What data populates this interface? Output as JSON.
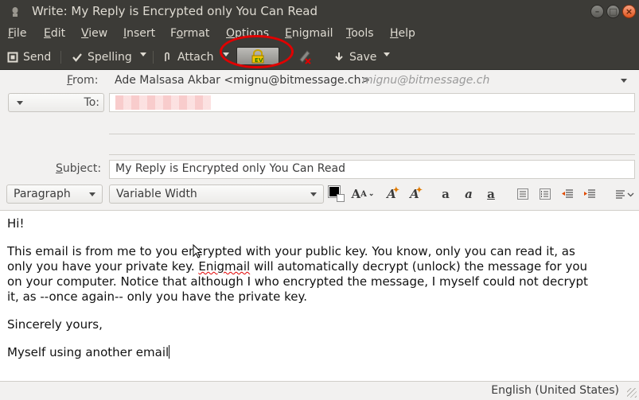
{
  "window": {
    "title": "Write: My Reply is Encrypted only You Can Read",
    "controls": [
      "–",
      "□",
      "×"
    ]
  },
  "menu": [
    {
      "label": "File",
      "accel": "F",
      "rest": "ile"
    },
    {
      "label": "Edit",
      "accel": "E",
      "rest": "dit"
    },
    {
      "label": "View",
      "accel": "V",
      "rest": "iew"
    },
    {
      "label": "Insert",
      "accel": "I",
      "rest": "nsert"
    },
    {
      "label": "Format",
      "pre": "F",
      "accel": "o",
      "rest": "rmat"
    },
    {
      "label": "Options",
      "accel": "O",
      "rest": "ptions"
    },
    {
      "label": "Enigmail",
      "accel": "E",
      "rest": "nigmail"
    },
    {
      "label": "Tools",
      "accel": "T",
      "rest": "ools"
    },
    {
      "label": "Help",
      "accel": "H",
      "rest": "elp"
    }
  ],
  "toolbar": {
    "send": "Send",
    "spelling": "Spelling",
    "attach": "Attach",
    "save": "Save",
    "encrypt_icon": "lock-key-icon",
    "sign_icon": "pen-x-icon"
  },
  "header": {
    "from_label": "From:",
    "from_value": "Ade Malsasa Akbar <mignu@bitmessage.ch>",
    "from_identity": "mignu@bitmessage.ch",
    "to_label": "To:",
    "subject_label": "Subject:",
    "subject_value": "My Reply is Encrypted only You Can Read"
  },
  "format": {
    "paragraph": "Paragraph",
    "font": "Variable Width"
  },
  "body": {
    "greeting": "Hi!",
    "para1_line1": "This email is from me to you encrypted with your public key. You know, only you can read it, as",
    "para1_line2_a": "only you have your private key. ",
    "para1_line2_spell": "Enigmail",
    "para1_line2_b": " will automatically decrypt (unlock) the message for you",
    "para1_line3": "on your computer. Notice that although I who encrypted the message, I myself could not decrypt",
    "para1_line4": "it, as --once again-- only you have the private key.",
    "closing": "Sincerely yours,",
    "signature": "Myself using another email"
  },
  "status": {
    "language": "English (United States)"
  },
  "colors": {
    "titlebar": "#3c3b37",
    "accent_red": "#e00000",
    "close_orange": "#e0561e"
  }
}
